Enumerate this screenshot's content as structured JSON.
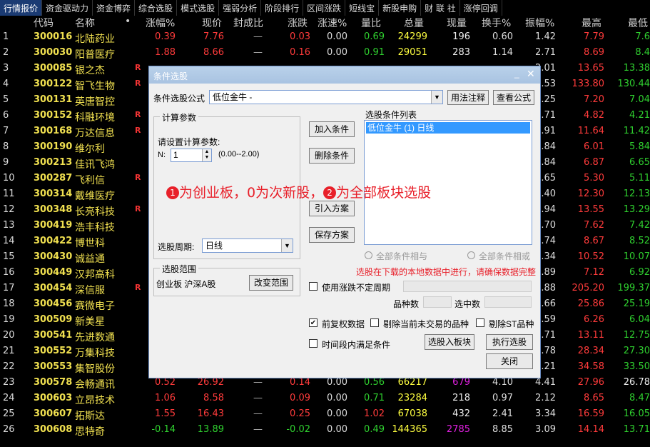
{
  "tabs": [
    "行情报价",
    "资金驱动力",
    "资金博弈",
    "综合选股",
    "模式选股",
    "强弱分析",
    "阶段排行",
    "区间涨跌",
    "短线宝",
    "新股申购",
    "财 联 社",
    "涨停回调"
  ],
  "headers": {
    "idx": "",
    "code": "代码",
    "name": "名称",
    "dot": "•",
    "chg": "涨幅%",
    "price": "现价",
    "seal": "封成比",
    "zd": "涨跌",
    "speed": "涨速%",
    "lb": "量比",
    "vol": "总量",
    "cur": "现量",
    "hs": "换手%",
    "zf": "振幅%",
    "high": "最高",
    "low": "最低"
  },
  "rows": [
    {
      "idx": "1",
      "code": "300016",
      "name": "北陆药业",
      "R": "",
      "chg": "0.39",
      "chgc": "red",
      "price": "7.76",
      "pc": "red",
      "seal": "—",
      "zd": "0.03",
      "zc": "red",
      "speed": "0.00",
      "lb": "0.69",
      "vol": "24299",
      "cur": "196",
      "curc": "white",
      "hs": "0.60",
      "zf": "1.42",
      "high": "7.79",
      "hc": "red",
      "low": "7.6",
      "lc": "green"
    },
    {
      "idx": "2",
      "code": "300030",
      "name": "阳普医疗",
      "R": "",
      "chg": "1.88",
      "chgc": "red",
      "price": "8.66",
      "pc": "red",
      "seal": "—",
      "zd": "0.16",
      "zc": "red",
      "speed": "0.00",
      "lb": "0.91",
      "vol": "29051",
      "cur": "283",
      "curc": "white",
      "hs": "1.14",
      "zf": "2.71",
      "high": "8.69",
      "hc": "red",
      "low": "8.4",
      "lc": "green"
    },
    {
      "idx": "3",
      "code": "300085",
      "name": "银之杰",
      "R": "R",
      "chg": "",
      "chgc": "red",
      "price": "",
      "pc": "red",
      "seal": "",
      "zd": "",
      "zc": "red",
      "speed": "",
      "lb": "",
      "vol": "",
      "cur": "",
      "curc": "white",
      "hs": "",
      "zf": "2.01",
      "high": "13.65",
      "hc": "red",
      "low": "13.38",
      "lc": "green"
    },
    {
      "idx": "4",
      "code": "300122",
      "name": "智飞生物",
      "R": "R",
      "chg": "",
      "chgc": "red",
      "price": "",
      "pc": "red",
      "seal": "",
      "zd": "",
      "zc": "red",
      "speed": "",
      "lb": "",
      "vol": "",
      "cur": "",
      "curc": "white",
      "hs": "",
      "zf": "2.53",
      "high": "133.80",
      "hc": "red",
      "low": "130.44",
      "lc": "green"
    },
    {
      "idx": "5",
      "code": "300131",
      "name": "英唐智控",
      "R": "",
      "chg": "",
      "chgc": "red",
      "price": "",
      "pc": "red",
      "seal": "",
      "zd": "",
      "zc": "red",
      "speed": "",
      "lb": "",
      "vol": "",
      "cur": "",
      "curc": "white",
      "hs": "",
      "zf": "2.25",
      "high": "7.20",
      "hc": "red",
      "low": "7.04",
      "lc": "green"
    },
    {
      "idx": "6",
      "code": "300152",
      "name": "科融环境",
      "R": "R",
      "chg": "",
      "chgc": "red",
      "price": "",
      "pc": "red",
      "seal": "",
      "zd": "",
      "zc": "red",
      "speed": "",
      "lb": "",
      "vol": "",
      "cur": "",
      "curc": "white",
      "hs": "",
      "zf": "8.71",
      "high": "4.82",
      "hc": "red",
      "low": "4.21",
      "lc": "green"
    },
    {
      "idx": "7",
      "code": "300168",
      "name": "万达信息",
      "R": "R",
      "chg": "",
      "chgc": "red",
      "price": "",
      "pc": "red",
      "seal": "",
      "zd": "",
      "zc": "red",
      "speed": "",
      "lb": "",
      "vol": "",
      "cur": "",
      "curc": "white",
      "hs": "",
      "zf": "1.91",
      "high": "11.64",
      "hc": "red",
      "low": "11.42",
      "lc": "green"
    },
    {
      "idx": "8",
      "code": "300190",
      "name": "维尔利",
      "R": "",
      "chg": "",
      "chgc": "red",
      "price": "",
      "pc": "red",
      "seal": "",
      "zd": "",
      "zc": "red",
      "speed": "",
      "lb": "",
      "vol": "",
      "cur": "",
      "curc": "white",
      "hs": "",
      "zf": "2.84",
      "high": "6.01",
      "hc": "red",
      "low": "5.84",
      "lc": "green"
    },
    {
      "idx": "9",
      "code": "300213",
      "name": "佳讯飞鸿",
      "R": "",
      "chg": "",
      "chgc": "red",
      "price": "",
      "pc": "red",
      "seal": "",
      "zd": "",
      "zc": "red",
      "speed": "",
      "lb": "",
      "vol": "",
      "cur": "",
      "curc": "white",
      "hs": "",
      "zf": "2.84",
      "high": "6.87",
      "hc": "red",
      "low": "6.65",
      "lc": "green"
    },
    {
      "idx": "10",
      "code": "300287",
      "name": "飞利信",
      "R": "R",
      "chg": "",
      "chgc": "red",
      "price": "",
      "pc": "red",
      "seal": "",
      "zd": "",
      "zc": "red",
      "speed": "",
      "lb": "",
      "vol": "",
      "cur": "",
      "curc": "white",
      "hs": "",
      "zf": "3.65",
      "high": "5.30",
      "hc": "red",
      "low": "5.11",
      "lc": "green"
    },
    {
      "idx": "11",
      "code": "300314",
      "name": "戴维医疗",
      "R": "",
      "chg": "",
      "chgc": "red",
      "price": "",
      "pc": "red",
      "seal": "",
      "zd": "",
      "zc": "red",
      "speed": "",
      "lb": "",
      "vol": "",
      "cur": "",
      "curc": "white",
      "hs": "",
      "zf": "1.40",
      "high": "12.30",
      "hc": "red",
      "low": "12.13",
      "lc": "green"
    },
    {
      "idx": "12",
      "code": "300348",
      "name": "长亮科技",
      "R": "R",
      "chg": "",
      "chgc": "red",
      "price": "",
      "pc": "red",
      "seal": "",
      "zd": "",
      "zc": "red",
      "speed": "",
      "lb": "",
      "vol": "",
      "cur": "",
      "curc": "white",
      "hs": "",
      "zf": "1.94",
      "high": "13.55",
      "hc": "red",
      "low": "13.29",
      "lc": "green"
    },
    {
      "idx": "13",
      "code": "300419",
      "name": "浩丰科技",
      "R": "",
      "chg": "",
      "chgc": "red",
      "price": "",
      "pc": "red",
      "seal": "",
      "zd": "",
      "zc": "red",
      "speed": "",
      "lb": "",
      "vol": "",
      "cur": "",
      "curc": "white",
      "hs": "",
      "zf": "2.70",
      "high": "7.62",
      "hc": "red",
      "low": "7.42",
      "lc": "green"
    },
    {
      "idx": "14",
      "code": "300422",
      "name": "博世科",
      "R": "",
      "chg": "",
      "chgc": "red",
      "price": "",
      "pc": "red",
      "seal": "",
      "zd": "",
      "zc": "red",
      "speed": "",
      "lb": "",
      "vol": "",
      "cur": "",
      "curc": "white",
      "hs": "",
      "zf": "1.74",
      "high": "8.67",
      "hc": "red",
      "low": "8.52",
      "lc": "green"
    },
    {
      "idx": "15",
      "code": "300430",
      "name": "诚益通",
      "R": "",
      "chg": "",
      "chgc": "red",
      "price": "",
      "pc": "red",
      "seal": "",
      "zd": "",
      "zc": "red",
      "speed": "",
      "lb": "",
      "vol": "",
      "cur": "",
      "curc": "white",
      "hs": "",
      "zf": "4.34",
      "high": "10.52",
      "hc": "red",
      "low": "10.07",
      "lc": "green"
    },
    {
      "idx": "16",
      "code": "300449",
      "name": "汉邦高科",
      "R": "",
      "chg": "",
      "chgc": "red",
      "price": "",
      "pc": "red",
      "seal": "",
      "zd": "",
      "zc": "red",
      "speed": "",
      "lb": "",
      "vol": "",
      "cur": "",
      "curc": "white",
      "hs": "",
      "zf": "2.89",
      "high": "7.12",
      "hc": "red",
      "low": "6.92",
      "lc": "green"
    },
    {
      "idx": "17",
      "code": "300454",
      "name": "深信服",
      "R": "R",
      "chg": "",
      "chgc": "red",
      "price": "",
      "pc": "red",
      "seal": "",
      "zd": "",
      "zc": "red",
      "speed": "",
      "lb": "",
      "vol": "",
      "cur": "",
      "curc": "white",
      "hs": "",
      "zf": "2.88",
      "high": "205.20",
      "hc": "red",
      "low": "199.37",
      "lc": "green"
    },
    {
      "idx": "18",
      "code": "300456",
      "name": "赛微电子",
      "R": "",
      "chg": "",
      "chgc": "red",
      "price": "",
      "pc": "red",
      "seal": "",
      "zd": "",
      "zc": "red",
      "speed": "",
      "lb": "",
      "vol": "",
      "cur": "",
      "curc": "white",
      "hs": "",
      "zf": "2.66",
      "high": "25.86",
      "hc": "red",
      "low": "25.19",
      "lc": "green"
    },
    {
      "idx": "19",
      "code": "300509",
      "name": "新美星",
      "R": "",
      "chg": "",
      "chgc": "red",
      "price": "",
      "pc": "red",
      "seal": "",
      "zd": "",
      "zc": "red",
      "speed": "",
      "lb": "",
      "vol": "",
      "cur": "",
      "curc": "white",
      "hs": "",
      "zf": "3.59",
      "high": "6.26",
      "hc": "red",
      "low": "6.04",
      "lc": "green"
    },
    {
      "idx": "20",
      "code": "300541",
      "name": "先进数通",
      "R": "",
      "chg": "",
      "chgc": "red",
      "price": "",
      "pc": "red",
      "seal": "",
      "zd": "",
      "zc": "red",
      "speed": "",
      "lb": "",
      "vol": "",
      "cur": "",
      "curc": "white",
      "hs": "",
      "zf": "2.71",
      "high": "13.11",
      "hc": "red",
      "low": "12.75",
      "lc": "green"
    },
    {
      "idx": "21",
      "code": "300552",
      "name": "万集科技",
      "R": "",
      "chg": "",
      "chgc": "red",
      "price": "",
      "pc": "red",
      "seal": "",
      "zd": "",
      "zc": "red",
      "speed": "",
      "lb": "",
      "vol": "",
      "cur": "",
      "curc": "white",
      "hs": "",
      "zf": "3.78",
      "high": "28.34",
      "hc": "red",
      "low": "27.30",
      "lc": "green"
    },
    {
      "idx": "22",
      "code": "300553",
      "name": "集智股份",
      "R": "",
      "chg": "",
      "chgc": "red",
      "price": "",
      "pc": "red",
      "seal": "",
      "zd": "",
      "zc": "red",
      "speed": "",
      "lb": "",
      "vol": "",
      "cur": "",
      "curc": "white",
      "hs": "",
      "zf": "3.21",
      "high": "34.58",
      "hc": "red",
      "low": "33.50",
      "lc": "green"
    },
    {
      "idx": "23",
      "code": "300578",
      "name": "会畅通讯",
      "R": "",
      "chg": "0.52",
      "chgc": "red",
      "price": "26.92",
      "pc": "red",
      "seal": "—",
      "zd": "0.14",
      "zc": "red",
      "speed": "0.00",
      "lb": "0.56",
      "vol": "66217",
      "cur": "679",
      "curc": "mag",
      "hs": "4.10",
      "zf": "4.41",
      "high": "27.96",
      "hc": "red",
      "low": "26.78",
      "lc": "white"
    },
    {
      "idx": "24",
      "code": "300603",
      "name": "立昂技术",
      "R": "",
      "chg": "1.06",
      "chgc": "red",
      "price": "8.58",
      "pc": "red",
      "seal": "—",
      "zd": "0.09",
      "zc": "red",
      "speed": "0.00",
      "lb": "0.71",
      "vol": "23284",
      "cur": "218",
      "curc": "white",
      "hs": "0.97",
      "zf": "2.12",
      "high": "8.65",
      "hc": "red",
      "low": "8.47",
      "lc": "green"
    },
    {
      "idx": "25",
      "code": "300607",
      "name": "拓斯达",
      "R": "",
      "chg": "1.55",
      "chgc": "red",
      "price": "16.43",
      "pc": "red",
      "seal": "—",
      "zd": "0.25",
      "zc": "red",
      "speed": "0.00",
      "lb": "1.02",
      "vol": "67038",
      "cur": "432",
      "curc": "white",
      "hs": "2.41",
      "zf": "3.34",
      "high": "16.59",
      "hc": "red",
      "low": "16.05",
      "lc": "green"
    },
    {
      "idx": "26",
      "code": "300608",
      "name": "思特奇",
      "R": "",
      "chg": "-0.14",
      "chgc": "green",
      "price": "13.89",
      "pc": "green",
      "seal": "—",
      "zd": "-0.02",
      "zc": "green",
      "speed": "0.00",
      "lb": "0.49",
      "vol": "144365",
      "cur": "2785",
      "curc": "mag",
      "hs": "8.85",
      "zf": "3.09",
      "high": "14.14",
      "hc": "red",
      "low": "13.71",
      "lc": "green"
    }
  ],
  "dialog": {
    "title": "条件选股",
    "formula_label": "条件选股公式",
    "formula_value": "低位金牛        -",
    "usage_btn": "用法注释",
    "view_btn": "查看公式",
    "calc_group": "计算参数",
    "calc_prompt": "请设置计算参数:",
    "n_label": "N:",
    "n_value": "1",
    "n_range": "(0.00--2.00)",
    "add_btn": "加入条件",
    "delete_btn": "删除条件",
    "import_btn": "引入方案",
    "save_btn": "保存方案",
    "list_title": "选股条件列表",
    "list_item": "低位金牛 (1) 日线",
    "period_label": "选股周期:",
    "period_value": "日线",
    "radio_and": "全部条件相与",
    "radio_or": "全部条件相或",
    "warning": "选股在下载的本地数据中进行，请确保数据完整",
    "range_group": "选股范围",
    "range_value": "创业板 沪深A股",
    "change_range_btn": "改变范围",
    "use_indef": "使用涨跌不定周期",
    "count_label": "品种数",
    "selected_label": "选中数",
    "pre_adjust": "前复权数据",
    "exclude_untraded": "剔除当前未交易的品种",
    "exclude_st": "剔除ST品种",
    "time_range": "时间段内满足条件",
    "to_board_btn": "选股入板块",
    "execute_btn": "执行选股",
    "close_btn": "关闭"
  },
  "annotation": {
    "n1": "1",
    "t1": "为创业板，0为次新股，",
    "n2": "2",
    "t2": "为全部板块选股"
  },
  "colors": {
    "accent": "#e8202a",
    "code": "#f0e050",
    "up": "#ff3b3b",
    "down": "#2fd02f"
  }
}
